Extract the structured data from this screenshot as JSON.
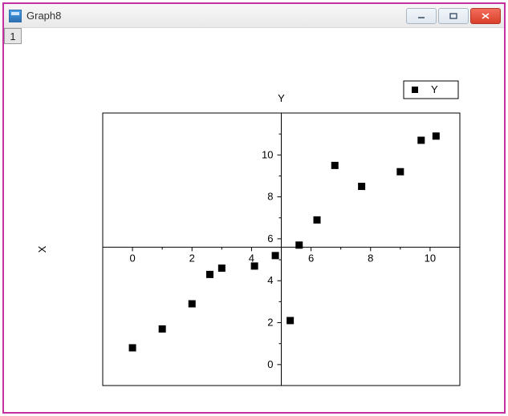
{
  "window": {
    "title": "Graph8"
  },
  "corner_tab": "1",
  "legend": {
    "entries": [
      {
        "marker": "square",
        "label": "Y"
      }
    ]
  },
  "chart_data": {
    "type": "scatter",
    "title": "",
    "xlabel": "X",
    "ylabel": "Y",
    "xlim": [
      -1,
      11
    ],
    "ylim": [
      -1,
      12
    ],
    "x_ticks": [
      0,
      2,
      4,
      6,
      8,
      10
    ],
    "y_ticks": [
      0,
      2,
      4,
      6,
      8,
      10
    ],
    "x_axis_position_y": 5.6,
    "y_axis_position_x": 5.0,
    "series": [
      {
        "name": "Y",
        "marker": "square",
        "color": "#000000",
        "points": [
          {
            "x": 0.0,
            "y": 0.8
          },
          {
            "x": 1.0,
            "y": 1.7
          },
          {
            "x": 2.0,
            "y": 2.9
          },
          {
            "x": 2.6,
            "y": 4.3
          },
          {
            "x": 3.0,
            "y": 4.6
          },
          {
            "x": 4.1,
            "y": 4.7
          },
          {
            "x": 4.8,
            "y": 5.2
          },
          {
            "x": 5.3,
            "y": 2.1
          },
          {
            "x": 5.6,
            "y": 5.7
          },
          {
            "x": 6.2,
            "y": 6.9
          },
          {
            "x": 6.8,
            "y": 9.5
          },
          {
            "x": 7.7,
            "y": 8.5
          },
          {
            "x": 9.0,
            "y": 9.2
          },
          {
            "x": 9.7,
            "y": 10.7
          },
          {
            "x": 10.2,
            "y": 10.9
          }
        ]
      }
    ]
  }
}
